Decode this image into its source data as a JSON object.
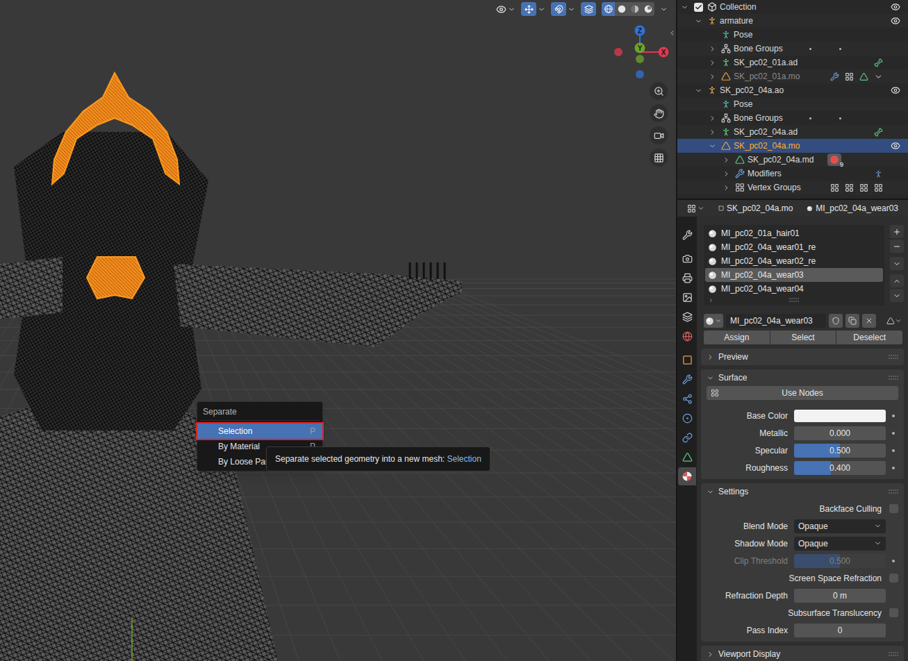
{
  "viewport": {
    "header": {
      "shading_modes": [
        {
          "kind": "wireframe",
          "selected": true
        },
        {
          "kind": "solid",
          "selected": false
        },
        {
          "kind": "material",
          "selected": false
        },
        {
          "kind": "rendered",
          "selected": false
        }
      ]
    },
    "gizmo": {
      "axes": [
        {
          "label": "Z",
          "color": "#2f72d9"
        },
        {
          "label": "Y",
          "color": "#6fa32a"
        },
        {
          "label": "X",
          "color": "#e0384f"
        }
      ]
    },
    "menu": {
      "title": "Separate",
      "items": [
        {
          "label": "Selection",
          "shortcut": "P",
          "selected": true,
          "annotated": true
        },
        {
          "label": "By Material",
          "shortcut": "P",
          "selected": false,
          "annotated": false
        },
        {
          "label": "By Loose Part",
          "shortcut": "",
          "selected": false,
          "annotated": false
        }
      ]
    },
    "tooltip": {
      "text": "Separate selected geometry into a new mesh:",
      "highlight": "Selection"
    }
  },
  "outliner": {
    "rows": [
      {
        "label": "Collection",
        "depth": 0,
        "kind": "collection",
        "expander": "open",
        "checkbox": true,
        "eye": true,
        "selected": false,
        "dimmed": false,
        "extras": []
      },
      {
        "label": "armature",
        "depth": 1,
        "kind": "armature",
        "expander": "open",
        "checkbox": false,
        "eye": true,
        "selected": false,
        "dimmed": false,
        "extras": []
      },
      {
        "label": "Pose",
        "depth": 2,
        "kind": "pose",
        "expander": "none",
        "checkbox": false,
        "eye": false,
        "selected": false,
        "dimmed": false,
        "extras": []
      },
      {
        "label": "Bone Groups",
        "depth": 2,
        "kind": "bone_groups",
        "expander": "closed",
        "checkbox": false,
        "eye": false,
        "selected": false,
        "dimmed": false,
        "extras": [
          "dots"
        ]
      },
      {
        "label": "SK_pc02_01a.ad",
        "depth": 2,
        "kind": "armature_data",
        "expander": "closed",
        "checkbox": false,
        "eye": false,
        "selected": false,
        "dimmed": false,
        "extras": [
          "bone"
        ]
      },
      {
        "label": "SK_pc02_01a.mo",
        "depth": 2,
        "kind": "mesh",
        "expander": "closed",
        "checkbox": false,
        "eye": false,
        "selected": false,
        "dimmed": true,
        "extras": [
          "wrench",
          "groups",
          "mesh_data",
          "more"
        ]
      },
      {
        "label": "SK_pc02_04a.ao",
        "depth": 1,
        "kind": "armature",
        "expander": "open",
        "checkbox": false,
        "eye": true,
        "selected": false,
        "dimmed": false,
        "extras": []
      },
      {
        "label": "Pose",
        "depth": 2,
        "kind": "pose",
        "expander": "none",
        "checkbox": false,
        "eye": false,
        "selected": false,
        "dimmed": false,
        "extras": []
      },
      {
        "label": "Bone Groups",
        "depth": 2,
        "kind": "bone_groups",
        "expander": "closed",
        "checkbox": false,
        "eye": false,
        "selected": false,
        "dimmed": false,
        "extras": [
          "dots"
        ]
      },
      {
        "label": "SK_pc02_04a.ad",
        "depth": 2,
        "kind": "armature_data",
        "expander": "closed",
        "checkbox": false,
        "eye": false,
        "selected": false,
        "dimmed": false,
        "extras": [
          "bone"
        ]
      },
      {
        "label": "SK_pc02_04a.mo",
        "depth": 2,
        "kind": "mesh",
        "expander": "open",
        "checkbox": false,
        "eye": true,
        "selected": true,
        "dimmed": false,
        "extras": []
      },
      {
        "label": "SK_pc02_04a.md",
        "depth": 3,
        "kind": "mesh_data",
        "expander": "closed",
        "checkbox": false,
        "eye": false,
        "selected": false,
        "dimmed": false,
        "extras": [
          "material_badge"
        ],
        "badge": "9"
      },
      {
        "label": "Modifiers",
        "depth": 3,
        "kind": "modifiers",
        "expander": "closed",
        "checkbox": false,
        "eye": false,
        "selected": false,
        "dimmed": false,
        "extras": [
          "armature_mod"
        ]
      },
      {
        "label": "Vertex Groups",
        "depth": 3,
        "kind": "vertex_groups",
        "expander": "closed",
        "checkbox": false,
        "eye": false,
        "selected": false,
        "dimmed": false,
        "extras": [
          "groups",
          "groups",
          "groups",
          "groups"
        ]
      }
    ]
  },
  "properties": {
    "header": {
      "object": "SK_pc02_04a.mo",
      "material": "MI_pc02_04a_wear03"
    },
    "tabs": [
      {
        "kind": "tool",
        "selected": false
      },
      {
        "kind": "render",
        "selected": false
      },
      {
        "kind": "output",
        "selected": false
      },
      {
        "kind": "view_layer",
        "selected": false
      },
      {
        "kind": "scene",
        "selected": false
      },
      {
        "kind": "world",
        "selected": false
      },
      {
        "kind": "object",
        "selected": false
      },
      {
        "kind": "modifiers",
        "selected": false
      },
      {
        "kind": "particles",
        "selected": false
      },
      {
        "kind": "physics",
        "selected": false
      },
      {
        "kind": "constraints",
        "selected": false
      },
      {
        "kind": "data",
        "selected": false
      },
      {
        "kind": "material",
        "selected": true
      }
    ],
    "slots": [
      {
        "label": "MI_pc02_01a_hair01",
        "selected": false
      },
      {
        "label": "MI_pc02_04a_wear01_re",
        "selected": false
      },
      {
        "label": "MI_pc02_04a_wear02_re",
        "selected": false
      },
      {
        "label": "MI_pc02_04a_wear03",
        "selected": true
      },
      {
        "label": "MI_pc02_04a_wear04",
        "selected": false
      }
    ],
    "material_name": "MI_pc02_04a_wear03",
    "slot_buttons": [
      "Assign",
      "Select",
      "Deselect"
    ],
    "panels": [
      {
        "title": "Preview",
        "expanded": false,
        "button": "",
        "rows": []
      },
      {
        "title": "Surface",
        "expanded": true,
        "button": "Use Nodes",
        "rows": [
          {
            "label": "Base Color",
            "kind": "color",
            "color": "#f2f2f2",
            "disabled": false
          },
          {
            "label": "Metallic",
            "kind": "slider",
            "value": "0.000",
            "level": 0,
            "disabled": false
          },
          {
            "label": "Specular",
            "kind": "slider",
            "value": "0.500",
            "level": 0.5,
            "disabled": false
          },
          {
            "label": "Roughness",
            "kind": "slider",
            "value": "0.400",
            "level": 0.4,
            "disabled": false
          }
        ]
      },
      {
        "title": "Settings",
        "expanded": true,
        "button": "",
        "rows": [
          {
            "label": "Backface Culling",
            "kind": "checkbox",
            "checked": false,
            "disabled": false
          },
          {
            "label": "Blend Mode",
            "kind": "select",
            "value": "Opaque",
            "disabled": false
          },
          {
            "label": "Shadow Mode",
            "kind": "select",
            "value": "Opaque",
            "disabled": false
          },
          {
            "label": "Clip Threshold",
            "kind": "slider",
            "value": "0.500",
            "level": 0.5,
            "disabled": true
          },
          {
            "label": "Screen Space Refraction",
            "kind": "checkbox",
            "checked": false,
            "disabled": false
          },
          {
            "label": "Refraction Depth",
            "kind": "number",
            "value": "0 m",
            "disabled": false
          },
          {
            "label": "Subsurface Translucency",
            "kind": "checkbox",
            "checked": false,
            "disabled": false
          },
          {
            "label": "Pass Index",
            "kind": "number",
            "value": "0",
            "disabled": false
          }
        ]
      },
      {
        "title": "Viewport Display",
        "expanded": false,
        "button": "",
        "rows": []
      }
    ]
  }
}
